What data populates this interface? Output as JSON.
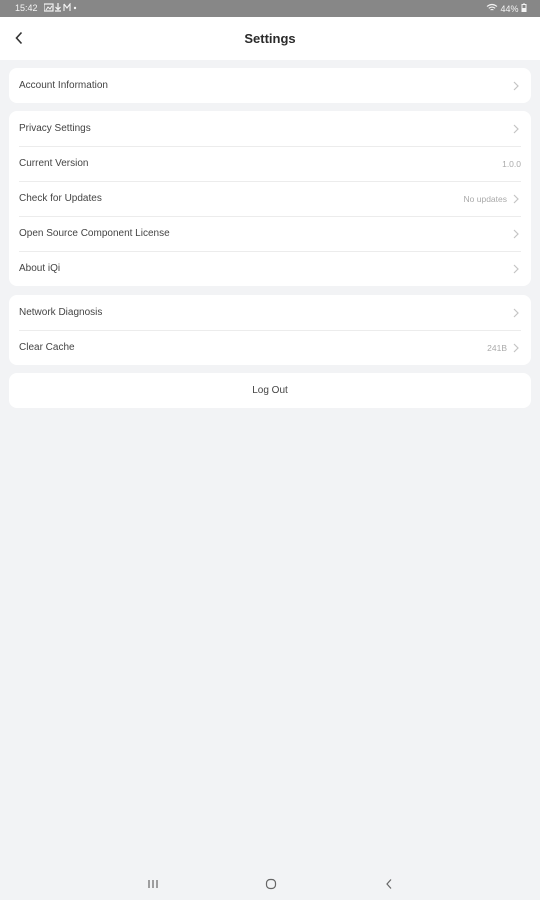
{
  "status_bar": {
    "time": "15:42",
    "battery": "44%"
  },
  "header": {
    "title": "Settings"
  },
  "group1": [
    {
      "label": "Account Information",
      "value": "",
      "chevron": true
    }
  ],
  "group2": [
    {
      "label": "Privacy Settings",
      "value": "",
      "chevron": true
    },
    {
      "label": "Current Version",
      "value": "1.0.0",
      "chevron": false
    },
    {
      "label": "Check for Updates",
      "value": "No updates",
      "chevron": true
    },
    {
      "label": "Open Source Component License",
      "value": "",
      "chevron": true
    },
    {
      "label": "About iQi",
      "value": "",
      "chevron": true
    }
  ],
  "group3": [
    {
      "label": "Network Diagnosis",
      "value": "",
      "chevron": true
    },
    {
      "label": "Clear Cache",
      "value": "241B",
      "chevron": true
    }
  ],
  "logout": {
    "label": "Log Out"
  },
  "colors": {
    "background": "#f2f3f5",
    "card": "#ffffff",
    "status_bar": "#878787"
  },
  "icons": [
    "back-arrow-icon",
    "chevron-right-icon",
    "recent-apps-icon",
    "home-icon",
    "back-nav-icon"
  ]
}
